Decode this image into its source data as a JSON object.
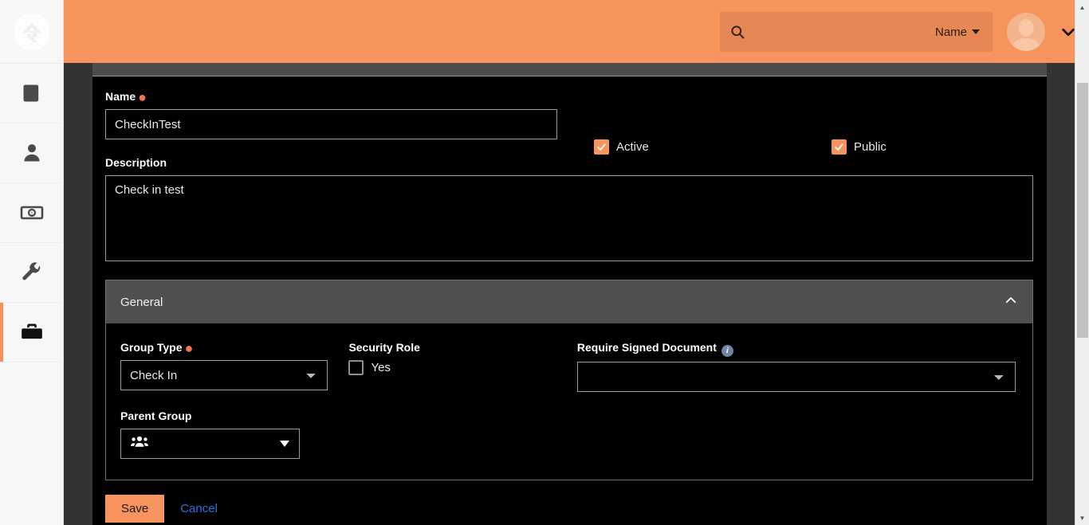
{
  "sidebar": {
    "logo_name": "rock-logo",
    "items": [
      {
        "name": "book-icon",
        "label": "Content"
      },
      {
        "name": "person-icon",
        "label": "People"
      },
      {
        "name": "money-icon",
        "label": "Finance"
      },
      {
        "name": "wrench-icon",
        "label": "Admin Tools"
      },
      {
        "name": "toolbox-icon",
        "label": "Tools",
        "active": true
      }
    ]
  },
  "header": {
    "search_placeholder": "",
    "search_value": "",
    "search_icon": "search-icon",
    "search_scope_label": "Name",
    "avatar_name": "avatar",
    "user_menu_icon": "chevron-down-icon"
  },
  "form": {
    "name_label": "Name",
    "name_required": true,
    "name_value": "CheckInTest",
    "name_placeholder": "",
    "active_label": "Active",
    "active_checked": true,
    "public_label": "Public",
    "public_checked": true,
    "description_label": "Description",
    "description_value": "Check in test",
    "description_placeholder": ""
  },
  "general_section": {
    "title": "General",
    "collapse_icon": "chevron-up-icon",
    "group_type_label": "Group Type",
    "group_type_required": true,
    "group_type_value": "Check In",
    "group_type_options": [
      "Check In"
    ],
    "security_role_label": "Security Role",
    "security_role_checkbox_label": "Yes",
    "security_role_checked": false,
    "require_signed_document_label": "Require Signed Document",
    "require_signed_document_info_icon": "info-icon",
    "require_signed_document_value": "",
    "require_signed_document_options": [
      ""
    ],
    "parent_group_label": "Parent Group",
    "parent_group_value": "",
    "parent_group_icon": "group-people-icon",
    "parent_group_caret_icon": "caret-down-icon"
  },
  "actions": {
    "save_label": "Save",
    "cancel_label": "Cancel"
  },
  "scrollbar": {
    "up_arrow": "▲",
    "down_arrow": "▼"
  },
  "colors": {
    "accent": "#f7935c",
    "panel_bg": "#000000",
    "section_head": "#4f4f4f",
    "link": "#2f6fe0",
    "required": "#f07551"
  }
}
